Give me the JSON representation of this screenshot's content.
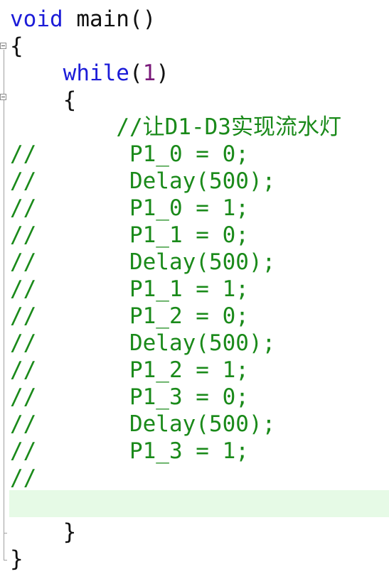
{
  "colors": {
    "keyword": "#1c1cd8",
    "comment": "#1a8a1a",
    "number": "#7a1a7a",
    "plain": "#111111",
    "current_line": "#e6fae6"
  },
  "code": {
    "l1_kw": "void",
    "l1_rest": " main()",
    "l2": "{",
    "l3_kw": "while",
    "l3_open": "(",
    "l3_num": "1",
    "l3_close": ")",
    "l4": "{",
    "l5": "//让D1-D3实现流水灯",
    "commented": [
      "//       P1_0 = 0;",
      "//       Delay(500);",
      "//       P1_0 = 1;",
      "//       P1_1 = 0;",
      "//       Delay(500);",
      "//       P1_1 = 1;",
      "//       P1_2 = 0;",
      "//       Delay(500);",
      "//       P1_2 = 1;",
      "//       P1_3 = 0;",
      "//       Delay(500);",
      "//       P1_3 = 1;",
      "//"
    ],
    "l20": "}",
    "l21": "}"
  }
}
